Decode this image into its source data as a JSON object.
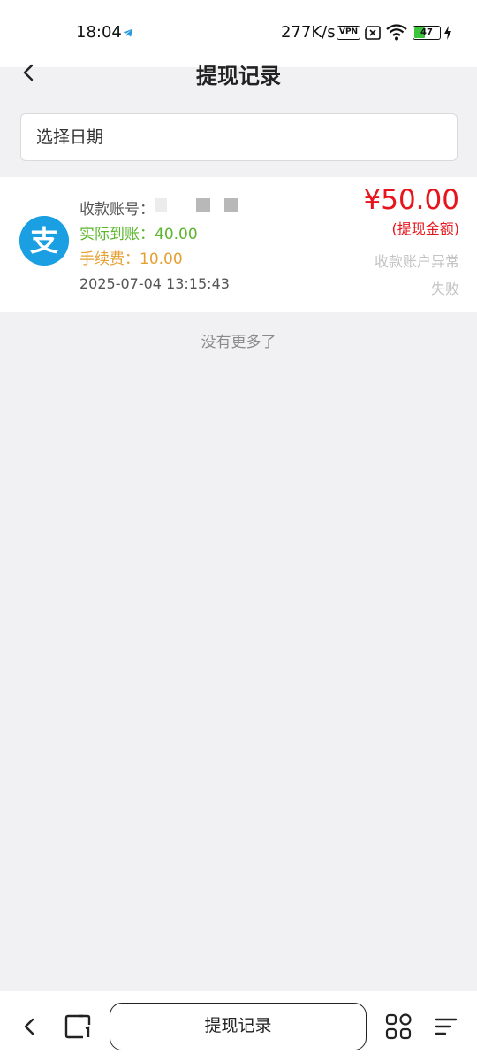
{
  "status_bar": {
    "time": "18:04",
    "network_speed": "277K/s",
    "vpn_label": "VPN",
    "battery_level": "47",
    "battery_fraction": 0.47,
    "icons": [
      "telegram-icon",
      "vpn-icon",
      "no-sim-icon",
      "wifi-icon",
      "battery-icon",
      "charging-icon"
    ]
  },
  "header": {
    "title": "提现记录",
    "back_icon": "chevron-left-icon"
  },
  "filter": {
    "date_placeholder": "选择日期"
  },
  "records": [
    {
      "icon": "alipay-icon",
      "icon_glyph": "支",
      "icon_color": "#1a9fe3",
      "account_label": "收款账号：",
      "actual_received": "实际到账：40.00",
      "fee": "手续费：10.00",
      "time": "2025-07-04 13:15:43",
      "amount": "¥50.00",
      "amount_label": "(提现金额)",
      "reason": "收款账户异常",
      "status": "失败"
    }
  ],
  "list_footer": "没有更多了",
  "browser_bar": {
    "url_label": "提现记录",
    "icons": [
      "back-icon",
      "tabs-icon",
      "apps-grid-icon",
      "menu-icon"
    ]
  },
  "colors": {
    "amount": "#e8141b",
    "actual": "#5cb62e",
    "fee": "#e5a033",
    "status": "#c3c3c3",
    "background": "#f1f1f3"
  }
}
